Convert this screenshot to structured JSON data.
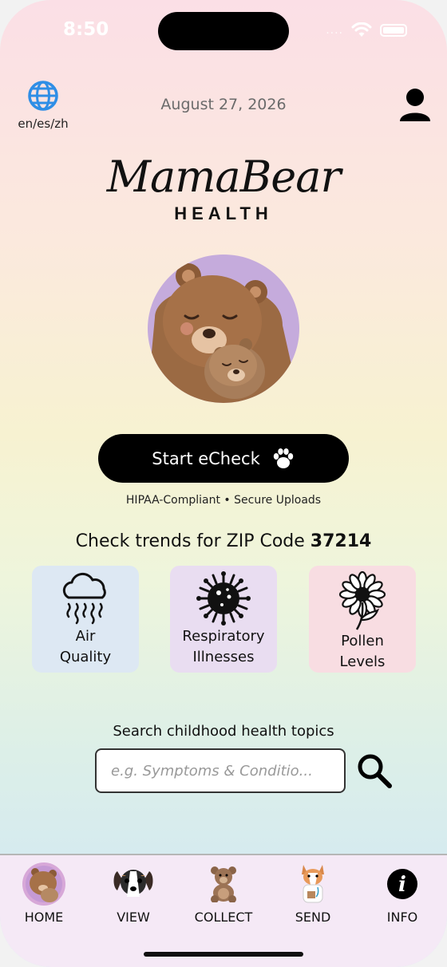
{
  "status_bar": {
    "time": "8:50",
    "signal": "....",
    "battery_level": 1.0
  },
  "header": {
    "language_label": "en/es/zh",
    "date": "August 27, 2026",
    "icons": {
      "language": "globe-icon",
      "profile": "person-icon"
    }
  },
  "logo": {
    "script": "MamaBear",
    "sub": "HEALTH"
  },
  "cta": {
    "label": "Start eCheck",
    "icon": "paw-icon",
    "subtext": "HIPAA-Compliant • Secure Uploads"
  },
  "trends": {
    "prefix": "Check trends for ZIP Code ",
    "zip": "37214",
    "cards": [
      {
        "line1": "Air",
        "line2": "Quality",
        "icon": "cloud-icon",
        "color": "#dde8f3"
      },
      {
        "line1": "Respiratory",
        "line2": "Illnesses",
        "icon": "virus-icon",
        "color": "#e9ddf1"
      },
      {
        "line1": "Pollen",
        "line2": "Levels",
        "icon": "flower-icon",
        "color": "#f8dde2"
      }
    ]
  },
  "search": {
    "label": "Search childhood health topics",
    "placeholder": "e.g. Symptoms & Conditio...",
    "icon": "magnifier-icon"
  },
  "tabbar": {
    "items": [
      {
        "label": "HOME",
        "icon": "bear-hug-icon",
        "active": true
      },
      {
        "label": "VIEW",
        "icon": "dog-face-icon",
        "active": false
      },
      {
        "label": "COLLECT",
        "icon": "teddy-bear-icon",
        "active": false
      },
      {
        "label": "SEND",
        "icon": "corgi-doctor-icon",
        "active": false
      },
      {
        "label": "INFO",
        "icon": "info-icon",
        "active": false
      }
    ]
  },
  "colors": {
    "accent": "#000000",
    "globe": "#2f8ee6",
    "tabbar_bg": "#f5e9f6"
  }
}
